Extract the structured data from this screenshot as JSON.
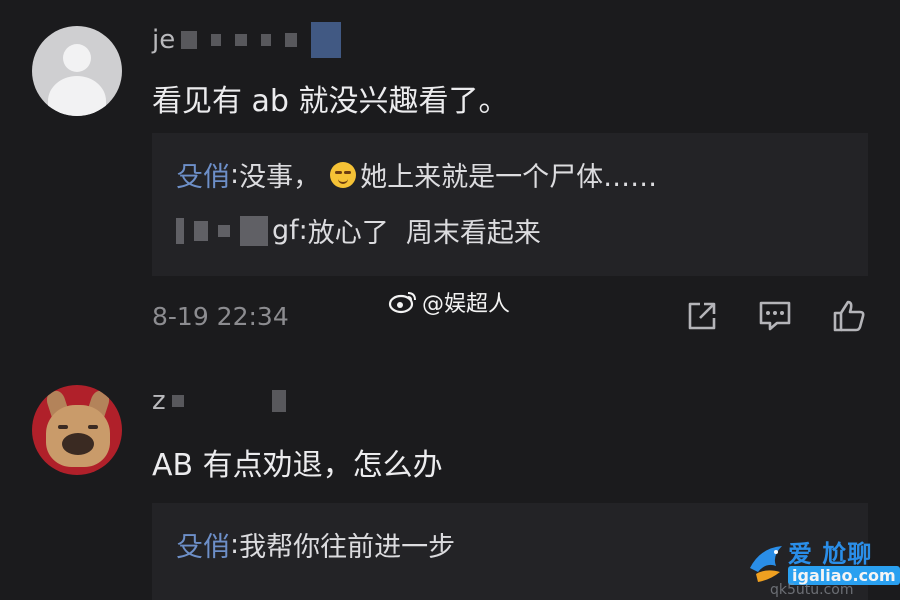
{
  "comments": [
    {
      "username_visible": "je",
      "text": "看见有 ab 就没兴趣看了。",
      "replies": [
        {
          "name": "殳俏",
          "text_before_emoji": "没事，",
          "emoji": "smiling-emoji",
          "text_after_emoji": "她上来就是一个尸体……"
        },
        {
          "name_suffix": "gf",
          "text": "放心了  周末看起来"
        }
      ],
      "timestamp": "8-19 22:34"
    },
    {
      "username_visible": "z",
      "text": "AB 有点劝退，怎么办",
      "replies": [
        {
          "name": "殳俏",
          "text": "我帮你往前进一步"
        }
      ]
    }
  ],
  "watermark": {
    "text": "@娱超人",
    "icon": "weibo-icon"
  },
  "actions": {
    "share_icon": "share-icon",
    "comment_icon": "comment-icon",
    "like_icon": "thumbs-up-icon"
  },
  "site_badge": {
    "main": "爱 尬聊",
    "url": "igaliao.com",
    "ghost": "qk5utu.com"
  },
  "colors": {
    "background": "#1b1b1d",
    "reply_box": "#232326",
    "reply_name": "#6d8fc8",
    "text": "#ececee",
    "muted": "#8c8c90"
  }
}
